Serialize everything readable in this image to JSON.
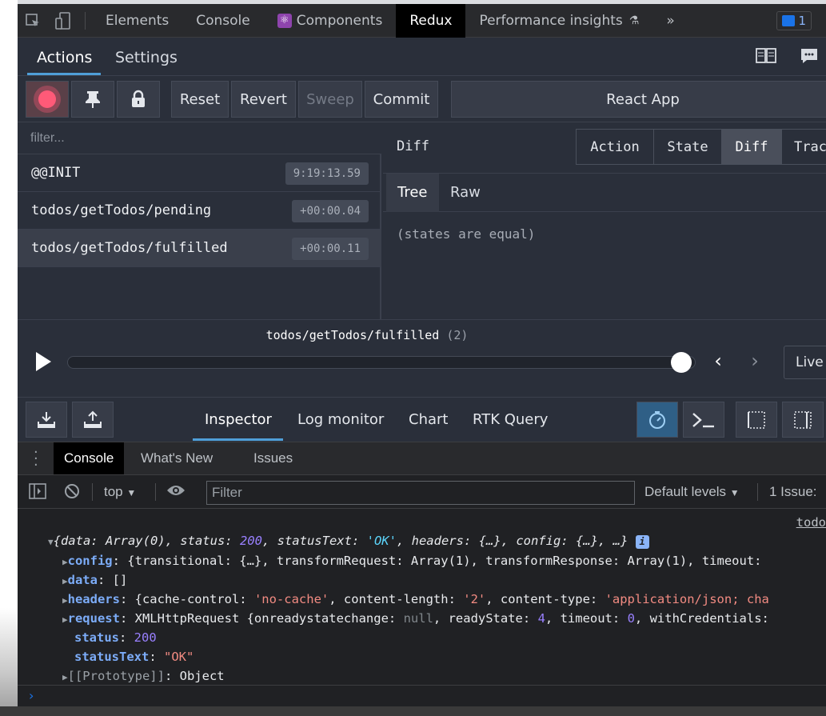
{
  "devtools": {
    "tabs": [
      {
        "label": "Elements"
      },
      {
        "label": "Console"
      },
      {
        "label": "Components"
      },
      {
        "label": "Redux"
      },
      {
        "label": "Performance insights"
      }
    ],
    "more_label": "»",
    "issues_count": "1"
  },
  "redux": {
    "top_tabs": {
      "actions": "Actions",
      "settings": "Settings"
    },
    "toolbar": {
      "reset": "Reset",
      "revert": "Revert",
      "sweep": "Sweep",
      "commit": "Commit",
      "instance": "React App"
    },
    "filter_placeholder": "filter...",
    "actions": [
      {
        "name": "@@INIT",
        "time": "9:19:13.59"
      },
      {
        "name": "todos/getTodos/pending",
        "time": "+00:00.04"
      },
      {
        "name": "todos/getTodos/fulfilled",
        "time": "+00:00.11"
      }
    ],
    "diff": {
      "title": "Diff",
      "view_tabs": {
        "action": "Action",
        "state": "State",
        "diff": "Diff",
        "trace": "Trac"
      },
      "sub_tabs": {
        "tree": "Tree",
        "raw": "Raw"
      },
      "message": "(states are equal)"
    },
    "slider": {
      "label": "todos/getTodos/fulfilled",
      "count": "(2)",
      "live": "Live",
      "position_fraction": 1.0
    },
    "monitor_tabs": {
      "inspector": "Inspector",
      "log_monitor": "Log monitor",
      "chart": "Chart",
      "rtk_query": "RTK Query"
    }
  },
  "drawer": {
    "tabs": {
      "console": "Console",
      "whats_new": "What's New",
      "issues": "Issues"
    },
    "context": "top",
    "filter_placeholder": "Filter",
    "levels": "Default levels",
    "issues_summary": "1 Issue:"
  },
  "console": {
    "source": "todo",
    "summary": {
      "open": "{",
      "k1": "data",
      "v1": "Array(0)",
      "k2": "status",
      "v2": "200",
      "k3": "statusText",
      "v3": "'OK'",
      "k4": "headers",
      "v4": "{…}",
      "k5": "config",
      "v5": "{…}",
      "tail": "…}"
    },
    "config": {
      "key": "config",
      "prefix": "{transitional: {…}, transformRequest: Array(1), transformResponse: Array(1), timeout: "
    },
    "data": {
      "key": "data",
      "value": "[]"
    },
    "headers": {
      "key": "headers",
      "a_key": "{cache-control: ",
      "a_val": "'no-cache'",
      "b_key": ", content-length: ",
      "b_val": "'2'",
      "c_key": ", content-type: ",
      "c_val": "'application/json; cha"
    },
    "request": {
      "key": "request",
      "prefix": "XMLHttpRequest {onreadystatechange: ",
      "null": "null",
      "rs": ", readyState: ",
      "rs_val": "4",
      "to": ", timeout: ",
      "to_val": "0",
      "wc": ", withCredentials: "
    },
    "status": {
      "key": "status",
      "value": "200"
    },
    "statusText": {
      "key": "statusText",
      "value": "\"OK\""
    },
    "prototype": {
      "key": "[[Prototype]]",
      "value": "Object"
    }
  }
}
